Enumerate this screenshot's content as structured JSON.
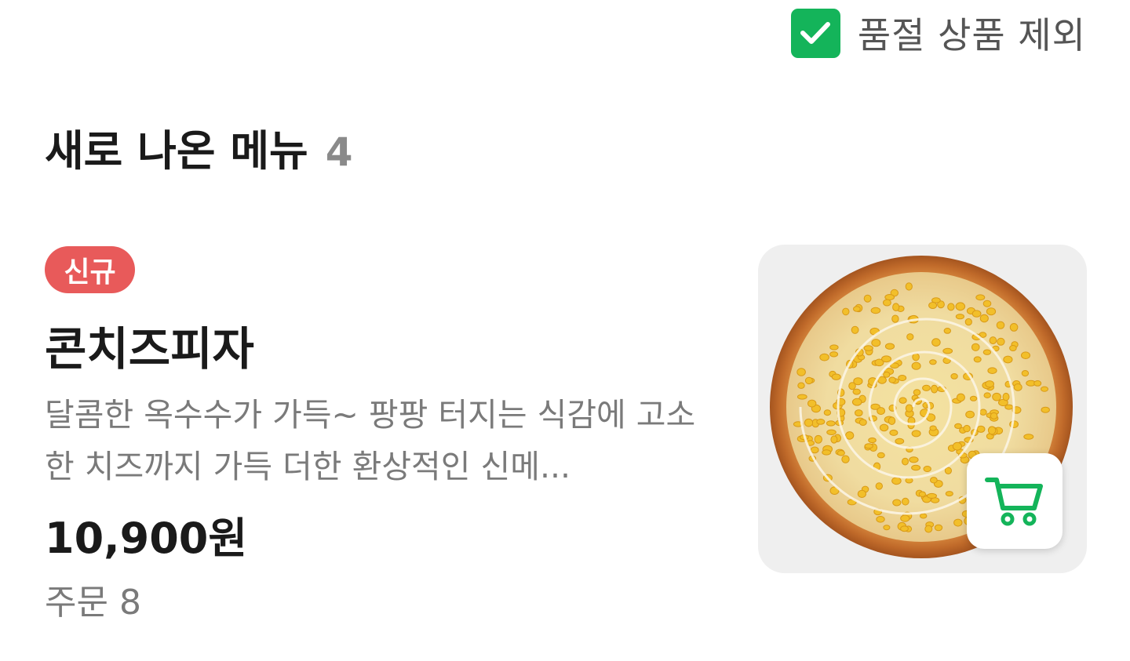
{
  "filter": {
    "exclude_sold_out_label": "품절 상품 제외",
    "checked": true,
    "accent_color": "#14b45a"
  },
  "section": {
    "title": "새로 나온 메뉴",
    "count": "4"
  },
  "menu_item": {
    "badge": "신규",
    "badge_color": "#e85a5a",
    "name": "콘치즈피자",
    "description": "달콤한 옥수수가 가득~ 팡팡 터지는 식감에 고소한 치즈까지 가득 더한 환상적인 신메...",
    "price": "10,900원",
    "orders": "주문 8",
    "image_icon": "pizza-image",
    "cart_icon": "cart-icon"
  }
}
